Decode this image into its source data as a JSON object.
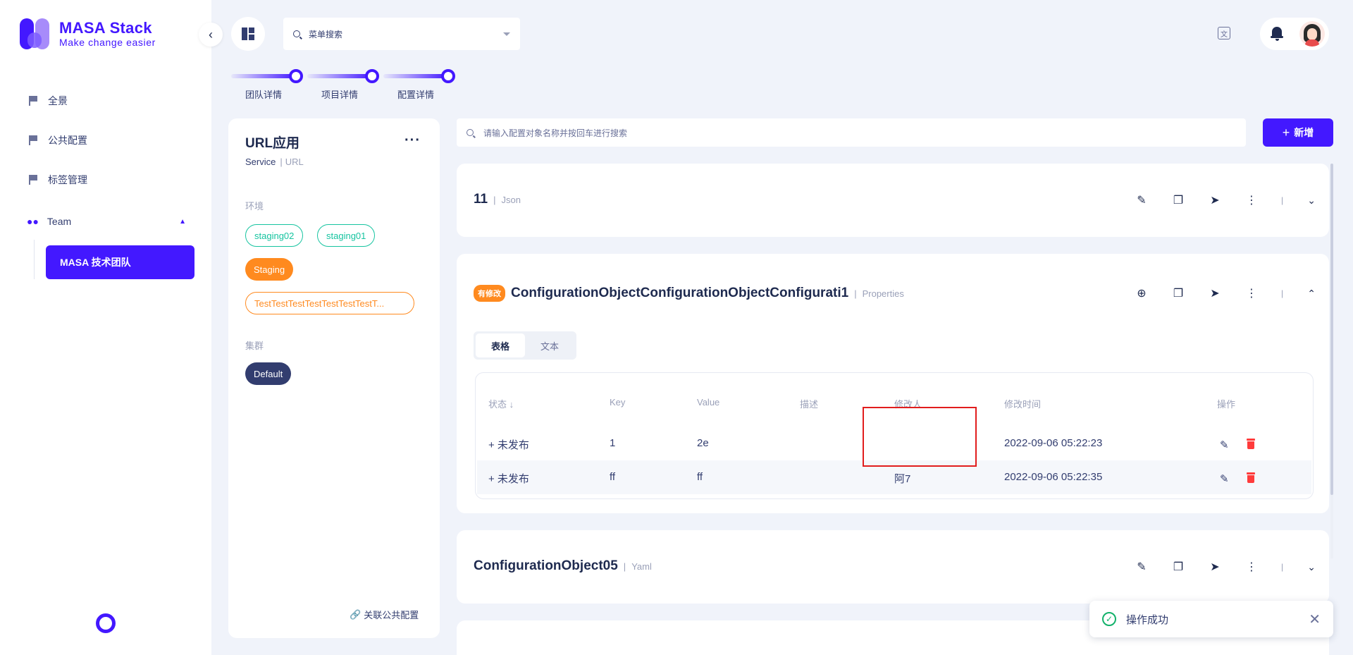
{
  "brand": {
    "title": "MASA Stack",
    "subtitle": "Make change easier"
  },
  "sidebar": {
    "items": [
      {
        "label": "全景",
        "icon": "flag-icon"
      },
      {
        "label": "公共配置",
        "icon": "flag-icon"
      },
      {
        "label": "标签管理",
        "icon": "flag-icon"
      }
    ],
    "team": {
      "label": "Team",
      "icon": "users-icon",
      "expanded": true,
      "children": [
        {
          "label": "MASA 技术团队",
          "active": true
        }
      ]
    }
  },
  "topbar": {
    "menu_search_placeholder": "菜单搜索"
  },
  "stepper": {
    "steps": [
      "团队详情",
      "项目详情",
      "配置详情"
    ]
  },
  "app_card": {
    "title": "URL应用",
    "type": "Service",
    "identity": "URL",
    "env_label": "环境",
    "environments": [
      {
        "name": "staging02",
        "style": "green-outline"
      },
      {
        "name": "staging01",
        "style": "green-outline"
      },
      {
        "name": "Staging",
        "style": "orange-filled",
        "selected": true
      },
      {
        "name": "TestTestTestTestTestTestTestT...",
        "style": "orange-outline"
      }
    ],
    "cluster_label": "集群",
    "clusters": [
      {
        "name": "Default",
        "selected": true
      }
    ],
    "link_public": "关联公共配置"
  },
  "config_search_placeholder": "请输入配置对象名称并按回车进行搜索",
  "add_button": "新增",
  "config_objects": [
    {
      "name": "11",
      "format": "Json",
      "expanded": false,
      "modified": false
    },
    {
      "name": "ConfigurationObjectConfigurationObjectConfigurati1",
      "format": "Properties",
      "expanded": true,
      "modified": true,
      "modified_badge": "有修改",
      "tabs": [
        {
          "label": "表格",
          "active": true
        },
        {
          "label": "文本",
          "active": false
        }
      ],
      "columns": [
        "状态",
        "Key",
        "Value",
        "描述",
        "修改人",
        "修改时间",
        "操作"
      ],
      "rows": [
        {
          "status": "+ 未发布",
          "key": "1",
          "value": "2e",
          "description": "",
          "modifier": "",
          "modified_time": "2022-09-06 05:22:23"
        },
        {
          "status": "+ 未发布",
          "key": "ff",
          "value": "ff",
          "description": "",
          "modifier": "阿7",
          "modified_time": "2022-09-06 05:22:35"
        }
      ]
    },
    {
      "name": "ConfigurationObject05",
      "format": "Yaml",
      "expanded": false,
      "modified": false
    }
  ],
  "toast": {
    "message": "操作成功",
    "status": "success"
  },
  "colors": {
    "primary": "#4318ff",
    "orange": "#ff8a1f",
    "green": "#16c4a0",
    "danger": "#ff3b3b",
    "navy": "#323d6f"
  }
}
